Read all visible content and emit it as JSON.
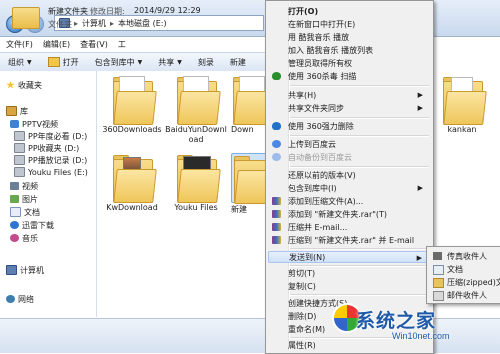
{
  "address": {
    "back_glyph": "◀",
    "forward_glyph": "▶",
    "crumbs": [
      "计算机",
      "本地磁盘 (E:)"
    ],
    "separator": "▸"
  },
  "menubar": [
    "文件(F)",
    "编辑(E)",
    "查看(V)",
    "工"
  ],
  "toolbar": {
    "organize": "组织",
    "open": "打开",
    "include": "包含到库中",
    "share": "共享",
    "burn": "刻录",
    "new": "新建"
  },
  "nav": {
    "favorites": "收藏夹",
    "library": "库",
    "pptv": "PPTV视频",
    "pptv_items": [
      "PP年度必看 (D:)",
      "PP收藏夹 (D:)",
      "PP播放记录 (D:)",
      "Youku Files (E:)"
    ],
    "video": "视频",
    "pictures": "图片",
    "documents": "文档",
    "thunder": "迅雷下载",
    "music": "音乐",
    "computer": "计算机",
    "network": "网络"
  },
  "files": [
    {
      "name": "360Downloads"
    },
    {
      "name": "BaiduYunDownload"
    },
    {
      "name": "Down"
    },
    {
      "name": "kankan"
    },
    {
      "name": "KwDownload"
    },
    {
      "name": "Youku Files"
    },
    {
      "name": "新建"
    }
  ],
  "status": {
    "name": "新建文件夹",
    "date_label": "修改日期:",
    "date": "2014/9/29 12:29",
    "type": "文件夹"
  },
  "context_menu": {
    "items": [
      {
        "label": "打开(O)",
        "bold": true
      },
      {
        "label": "在新窗口中打开(E)"
      },
      {
        "label": "用 酷我音乐 播放"
      },
      {
        "label": "加入 酷我音乐 播放列表"
      },
      {
        "label": "管理员取得所有权"
      },
      {
        "label": "使用 360杀毒 扫描",
        "icon": "shield"
      },
      {
        "label": "共享(H)",
        "submenu": true
      },
      {
        "label": "共享文件夹同步",
        "submenu": true
      },
      {
        "label": "使用 360强力删除",
        "icon": "shield2"
      },
      {
        "label": "上传到百度云",
        "icon": "baidu"
      },
      {
        "label": "自动备份到百度云",
        "icon": "baidu",
        "disabled": true
      },
      {
        "label": "还原以前的版本(V)"
      },
      {
        "label": "包含到库中(I)",
        "submenu": true
      },
      {
        "label": "添加到压缩文件(A)...",
        "icon": "rar"
      },
      {
        "label": "添加到 \"新建文件夹.rar\"(T)",
        "icon": "rar"
      },
      {
        "label": "压缩并 E-mail...",
        "icon": "rar"
      },
      {
        "label": "压缩到 \"新建文件夹.rar\" 并 E-mail",
        "icon": "rar"
      },
      {
        "label": "发送到(N)",
        "submenu": true,
        "hover": true
      },
      {
        "label": "剪切(T)"
      },
      {
        "label": "复制(C)"
      },
      {
        "label": "创建快捷方式(S)"
      },
      {
        "label": "删除(D)"
      },
      {
        "label": "重命名(M)"
      },
      {
        "label": "属性(R)"
      }
    ],
    "submenu_arrow": "▶"
  },
  "sendto": [
    {
      "label": "传真收件人",
      "icon": "fax"
    },
    {
      "label": "文档",
      "icon": "docs"
    },
    {
      "label": "压缩(zipped)文件",
      "icon": "zip"
    },
    {
      "label": "邮件收件人",
      "icon": "mail"
    }
  ],
  "watermark": {
    "brand": "系统之家",
    "url": "Win10net.com"
  }
}
